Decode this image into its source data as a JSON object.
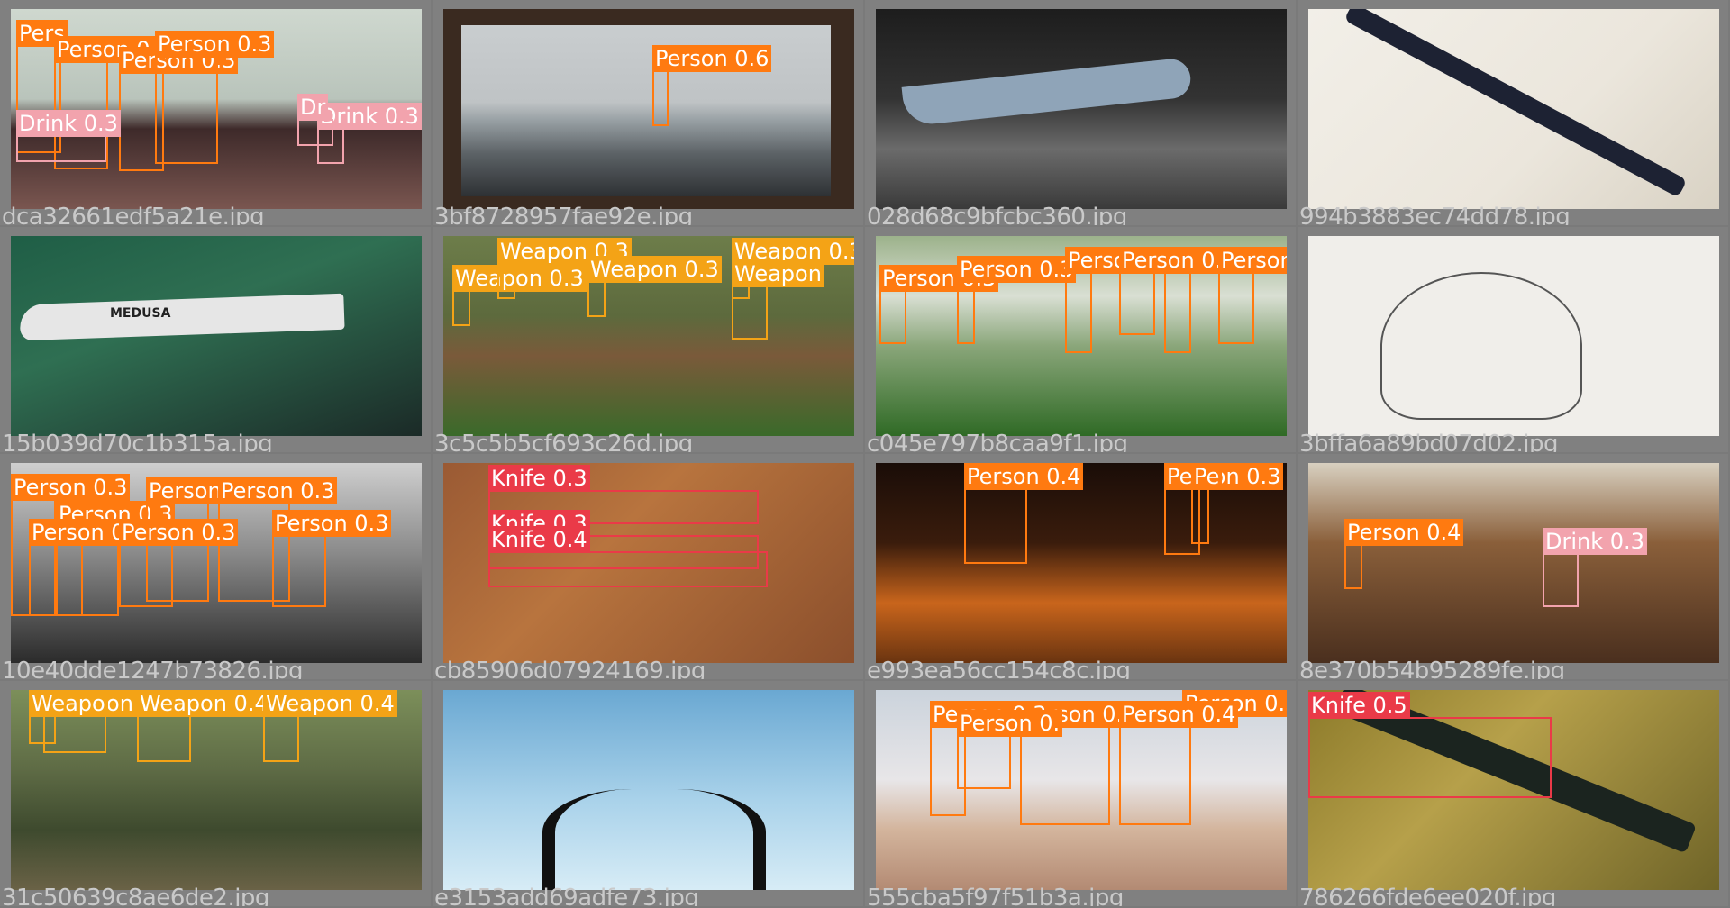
{
  "tiles": [
    {
      "file": "dca32661edf5a21e.jpg",
      "boxes": [
        {
          "cls": "person",
          "label": "Pers"
        },
        {
          "cls": "person",
          "label": "Person 0.3"
        },
        {
          "cls": "person",
          "label": "Person 0.3"
        },
        {
          "cls": "person",
          "label": "Person 0.3"
        },
        {
          "cls": "drink",
          "label": "Drink 0.3"
        },
        {
          "cls": "drink",
          "label": "Drink 0.3"
        },
        {
          "cls": "drink",
          "label": "Dr"
        }
      ]
    },
    {
      "file": "3bf8728957fae92e.jpg",
      "boxes": [
        {
          "cls": "person",
          "label": "Person 0.6"
        }
      ]
    },
    {
      "file": "028d68c9bfcbc360.jpg",
      "boxes": []
    },
    {
      "file": "994b3883ec74dd78.jpg",
      "boxes": []
    },
    {
      "file": "15b039d70c1b315a.jpg",
      "boxes": [],
      "overlay_text": "MEDUSA"
    },
    {
      "file": "3c5c5b5cf693c26d.jpg",
      "boxes": [
        {
          "cls": "weapon",
          "label": "Weapon 0.3"
        },
        {
          "cls": "weapon",
          "label": "Weapon 0.3"
        },
        {
          "cls": "weapon",
          "label": "Weapon 0.3"
        },
        {
          "cls": "weapon",
          "label": "Weapon 0.3"
        },
        {
          "cls": "weapon",
          "label": "Weapon"
        }
      ]
    },
    {
      "file": "c045e797b8caa9f1.jpg",
      "boxes": [
        {
          "cls": "person",
          "label": "Person 0.3"
        },
        {
          "cls": "person",
          "label": "Person 0.3"
        },
        {
          "cls": "person",
          "label": "Person 0.3"
        },
        {
          "cls": "person",
          "label": "Person 0.3"
        },
        {
          "cls": "person",
          "label": "Person 0.3"
        },
        {
          "cls": "person",
          "label": "Person 0.4"
        }
      ]
    },
    {
      "file": "3bffa6a89bd07d02.jpg",
      "boxes": []
    },
    {
      "file": "10e40dde1247b73826.jpg",
      "boxes": [
        {
          "cls": "person",
          "label": "Person 0.3"
        },
        {
          "cls": "person",
          "label": "Person 0.3"
        },
        {
          "cls": "person",
          "label": "Person 0.3"
        },
        {
          "cls": "person",
          "label": "Person 0.3"
        },
        {
          "cls": "person",
          "label": "Person 0.4"
        },
        {
          "cls": "person",
          "label": "Person 0.3"
        },
        {
          "cls": "person",
          "label": "Person 0.3"
        }
      ]
    },
    {
      "file": "cb85906d07924169.jpg",
      "boxes": [
        {
          "cls": "knife",
          "label": "Knife 0.3"
        },
        {
          "cls": "knife",
          "label": "Knife 0.3"
        },
        {
          "cls": "knife",
          "label": "Knife 0.4"
        }
      ]
    },
    {
      "file": "e993ea56cc154c8c.jpg",
      "boxes": [
        {
          "cls": "person",
          "label": "Person 0.4"
        },
        {
          "cls": "person",
          "label": "Person 0.3"
        },
        {
          "cls": "person",
          "label": "Pe"
        }
      ]
    },
    {
      "file": "8e370b54b95289fe.jpg",
      "boxes": [
        {
          "cls": "person",
          "label": "Person 0.4"
        },
        {
          "cls": "drink",
          "label": "Drink 0.3"
        }
      ]
    },
    {
      "file": "31c50639c8ae6de2.jpg",
      "boxes": [
        {
          "cls": "weapon",
          "label": "Weapon 0.3"
        },
        {
          "cls": "weapon",
          "label": "Weapon 0.4"
        },
        {
          "cls": "weapon",
          "label": "Weapon 0.4"
        },
        {
          "cls": "weapon",
          "label": "Weapo"
        }
      ]
    },
    {
      "file": "e3153add69adfe73.jpg",
      "boxes": []
    },
    {
      "file": "555cba5f97f51b3a.jpg",
      "boxes": [
        {
          "cls": "person",
          "label": "Person 0.5"
        },
        {
          "cls": "person",
          "label": "Person 0.3"
        },
        {
          "cls": "person",
          "label": "Person 0.4"
        },
        {
          "cls": "person",
          "label": "Person 0.3"
        },
        {
          "cls": "person",
          "label": "Person 0."
        }
      ]
    },
    {
      "file": "786266fde6ee020f.jpg",
      "boxes": [
        {
          "cls": "knife",
          "label": "Knife 0.5"
        }
      ]
    }
  ]
}
